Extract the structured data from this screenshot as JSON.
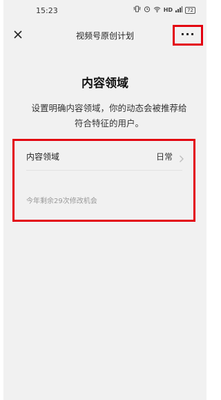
{
  "status_bar": {
    "time": "15:23",
    "hd": "HD",
    "battery": "72"
  },
  "nav": {
    "title": "视频号原创计划",
    "close_icon": "close-icon",
    "more_label": "···"
  },
  "page": {
    "heading": "内容领域",
    "description": "设置明确内容领域，你的动态会被推荐给符合特征的用户。"
  },
  "card": {
    "row_label": "内容领域",
    "row_value": "日常",
    "note": "今年剩余29次修改机会"
  },
  "colors": {
    "highlight": "#e3000f",
    "background": "#f1f1f1"
  }
}
